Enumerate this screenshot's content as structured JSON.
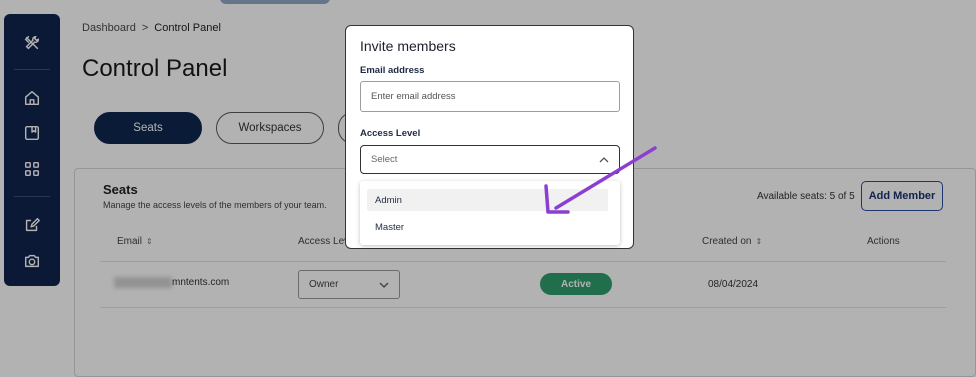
{
  "breadcrumb": {
    "parent": "Dashboard",
    "separator": ">",
    "current": "Control Panel"
  },
  "page_title": "Control Panel",
  "tabs": [
    {
      "label": "Seats",
      "active": true
    },
    {
      "label": "Workspaces",
      "active": false
    },
    {
      "label": "",
      "active": false
    }
  ],
  "sidebar": {
    "icons": [
      "tools-icon",
      "home-icon",
      "book-icon",
      "grid-icon",
      "edit-icon",
      "camera-icon"
    ]
  },
  "seats": {
    "title": "Seats",
    "description": "Manage the access levels of the members of your team.",
    "available_label": "Available seats: 5 of 5",
    "add_member_label": "Add Member"
  },
  "table": {
    "headers": {
      "email": "Email",
      "access_level": "Access Level",
      "created_on": "Created on",
      "actions": "Actions"
    },
    "rows": [
      {
        "email": "mntents.com",
        "access": "Owner",
        "status": "Active",
        "created_on": "08/04/2024"
      }
    ]
  },
  "modal": {
    "title": "Invite members",
    "email_label": "Email address",
    "email_placeholder": "Enter email address",
    "access_label": "Access Level",
    "access_placeholder": "Select",
    "options": [
      "Admin",
      "Master"
    ]
  },
  "colors": {
    "sidebar": "#10244e",
    "primary": "#0f2850",
    "active_badge": "#2e9e6e",
    "annotation_arrow": "#8b3fd1"
  }
}
